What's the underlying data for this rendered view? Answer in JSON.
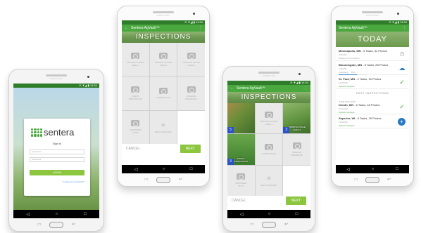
{
  "common": {
    "brand_label": "SAMSUNG",
    "status_bar": "⊝ ▼◢ ▮ 14:54",
    "nav": {
      "back": "◁",
      "home": "○",
      "recents": "□"
    },
    "hw": {
      "back": "↩",
      "menu": "▭"
    },
    "app_title": "Sentera AgVault™",
    "inspections_heading": "INSPECTIONS",
    "cancel_label": "CANCEL",
    "next_label": "NEXT"
  },
  "login": {
    "logo_text": "sentera",
    "signin_label": "Sign in",
    "username_placeholder": "Username",
    "password_placeholder": "Password",
    "login_button": "LOGIN",
    "forgot_link": "Forgot your password?"
  },
  "grid_b": [
    {
      "label": "GROWTH STAGE\nAREA 1"
    },
    {
      "label": "GROWTH STAGE\nAREA 2"
    },
    {
      "label": "GROWTH STAGE\nAREA 3"
    },
    {
      "label": "INSECT\nINFESTATION"
    },
    {
      "label": "COMPACTION"
    },
    {
      "label": "DISEASE\nPRESENCE"
    },
    {
      "label": "DROWNED\nOUTS"
    },
    {
      "label": "NEW CATEGORY"
    }
  ],
  "grid_c": [
    {
      "label": "",
      "count": "5"
    },
    {
      "label": "GROWTH STAGE\nAREA 2",
      "count": ""
    },
    {
      "label": "GROWTH STAGE\nAREA 3",
      "count": "3"
    },
    {
      "label": "INSECT\nINFESTATION",
      "count": "3"
    },
    {
      "label": "COMPACTION",
      "count": ""
    },
    {
      "label": "DISEASE\nPRESENCE",
      "count": ""
    },
    {
      "label": "DROWNED\nOUTS",
      "count": ""
    },
    {
      "label": "NEW CATEGORY",
      "count": ""
    }
  ],
  "dashboard": {
    "today_heading": "TODAY",
    "items": [
      {
        "place": "Minneapolis, MN",
        "detail": " - 5 Tasks, 34 Photos",
        "time": "3:45 PM",
        "status": "Waiting for connection",
        "action": "clock"
      },
      {
        "place": "Bloomington, MN",
        "detail": " - 8 Tasks, 83 Photos",
        "time": "2:20 PM",
        "status": "Uploading",
        "percent": "65%",
        "progress": 0.65,
        "action": "cloud"
      },
      {
        "place": "St. Paul, MN",
        "detail": " - 2 Tasks, 15 Photos",
        "time": "11:35 AM",
        "status": "Upload complete",
        "action": "check"
      }
    ],
    "past_heading": "PAST INSPECTIONS",
    "past_items": [
      {
        "date": "JUNE 10TH 2015",
        "place": "Duluth, MN",
        "detail": " - 6 Tasks, 46 Photos",
        "time": "10:21 AM",
        "status": "Upload complete",
        "action": "check"
      },
      {
        "place": "Superior, WI",
        "detail": " - 6 Tasks, 30 Photos",
        "time": "11:35 AM",
        "status": "Upload complete",
        "action": "fab"
      }
    ]
  },
  "icons": {
    "kebab": "⋮",
    "back_arrow": "←",
    "plus": "+",
    "check": "✓",
    "clock": "◷",
    "cloud": "☁",
    "fab_plus": "+"
  },
  "colors": {
    "brand_green": "#4aa83f",
    "button_green": "#8cc63f",
    "status_dark_green": "#2f7d2a",
    "badge_blue": "#2b52c4",
    "action_blue": "#2a79c5"
  }
}
